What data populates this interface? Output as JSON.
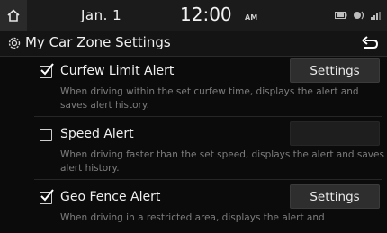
{
  "status": {
    "date": "Jan.  1",
    "time": "12:00",
    "ampm": "AM"
  },
  "title": {
    "text": "My Car Zone Settings"
  },
  "items": [
    {
      "label": "Curfew Limit Alert",
      "checked": true,
      "description": "When driving within the set curfew time, displays the alert and saves alert history.",
      "button_label": "Settings",
      "button_enabled": true
    },
    {
      "label": "Speed Alert",
      "checked": false,
      "description": "When driving faster than the set speed, displays the alert and saves alert history.",
      "button_label": "",
      "button_enabled": false
    },
    {
      "label": "Geo Fence Alert",
      "checked": true,
      "description": "When driving in a restricted area, displays the alert and",
      "button_label": "Settings",
      "button_enabled": true
    }
  ],
  "colors": {
    "background": "#0b0b0b",
    "status_bar": "#1b1b1b",
    "title_bar": "#141414",
    "button": "#2e2e2e",
    "text": "#f0f0f0",
    "description": "#7d7d7d"
  }
}
